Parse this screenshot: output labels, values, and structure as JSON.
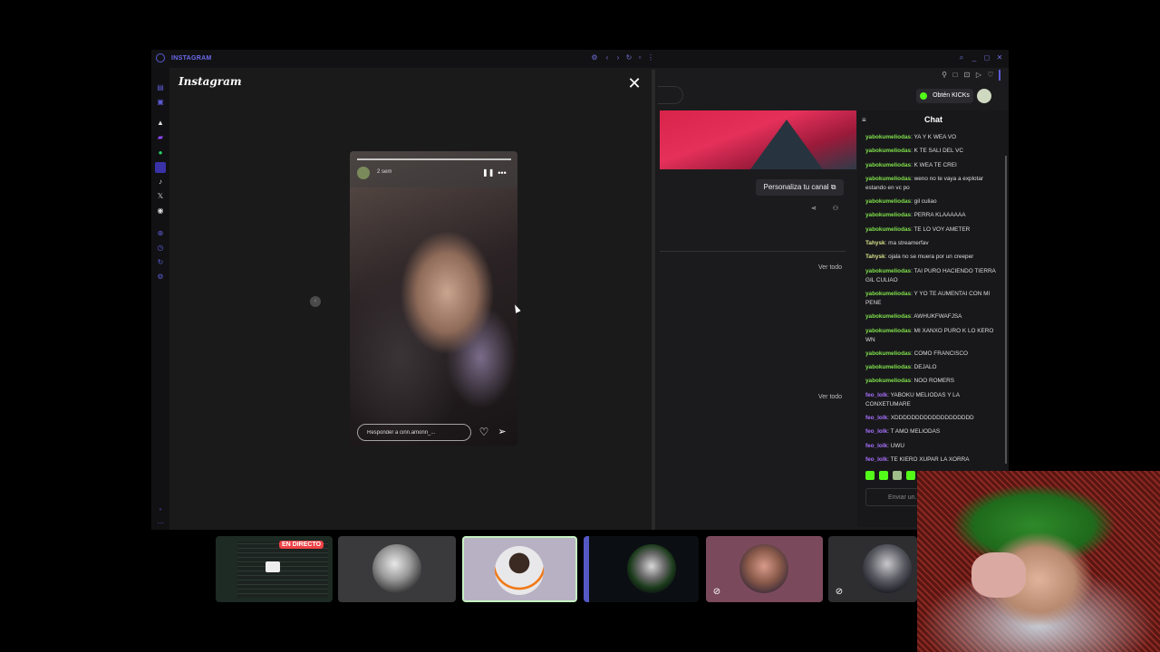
{
  "window": {
    "app_title": "INSTAGRAM",
    "accent": "#6b6bf0"
  },
  "instagram": {
    "logo": "Instagram",
    "close_glyph": "✕",
    "story": {
      "user": "",
      "time": "2 sem",
      "reply_placeholder": "Responder a cinn.amonn_..."
    }
  },
  "kick": {
    "obten_label": "Obtén KICKs",
    "personaliza_label": "Personaliza tu canal ⧉",
    "ver_todo_1": "Ver todo",
    "ver_todo_2": "Ver todo",
    "brand_color": "#53fc18"
  },
  "chat": {
    "title": "Chat",
    "input_placeholder": "Enviar un...",
    "messages": [
      {
        "user": "yabokumeliodas",
        "text": "YA Y K WEA VO",
        "color": "g"
      },
      {
        "user": "yabokumeliodas",
        "text": "K TE SALI DEL VC",
        "color": "g"
      },
      {
        "user": "yabokumeliodas",
        "text": "K WEA TE CREI",
        "color": "g"
      },
      {
        "user": "yabokumeliodas",
        "text": "weno no te vaya a explotar estando en vc po",
        "color": "g"
      },
      {
        "user": "yabokumeliodas",
        "text": "gil culiao",
        "color": "g"
      },
      {
        "user": "yabokumeliodas",
        "text": "PERRA KLAAAAAA",
        "color": "g"
      },
      {
        "user": "yabokumeliodas",
        "text": "TE LO VOY AMETER",
        "color": "g"
      },
      {
        "user": "Tahysk",
        "text": "ma streamerfav",
        "color": "y"
      },
      {
        "user": "Tahysk",
        "text": "ojala no se muera por un creeper",
        "color": "y"
      },
      {
        "user": "yabokumeliodas",
        "text": "TAI PURO HACIENDO TIERRA GIL CULIAO",
        "color": "g"
      },
      {
        "user": "yabokumeliodas",
        "text": "Y YO TE AUMENTAI CON MI PENE",
        "color": "g"
      },
      {
        "user": "yabokumeliodas",
        "text": "AWHUKFWAFJSA",
        "color": "g"
      },
      {
        "user": "yabokumeliodas",
        "text": "MI XANXO PURO K LO KERO WN",
        "color": "g"
      },
      {
        "user": "yabokumeliodas",
        "text": "COMO FRANCISCO",
        "color": "g"
      },
      {
        "user": "yabokumeliodas",
        "text": "DEJALO",
        "color": "g"
      },
      {
        "user": "yabokumeliodas",
        "text": "NOO ROMERS",
        "color": "g"
      },
      {
        "user": "feo_lolk",
        "text": "YABOKU MELIODAS Y LA CONXETUMARE",
        "color": "p"
      },
      {
        "user": "feo_lolk",
        "text": "XDDDDDDDDDDDDDDDDDDD",
        "color": "p"
      },
      {
        "user": "feo_lolk",
        "text": "T AMO MELIODAS",
        "color": "p"
      },
      {
        "user": "feo_lolk",
        "text": "UWU",
        "color": "p"
      },
      {
        "user": "feo_lolk",
        "text": "TE KIERO XUPAR LA XORRA",
        "color": "p"
      }
    ]
  },
  "call": {
    "live_badge": "EN DIRECTO"
  }
}
